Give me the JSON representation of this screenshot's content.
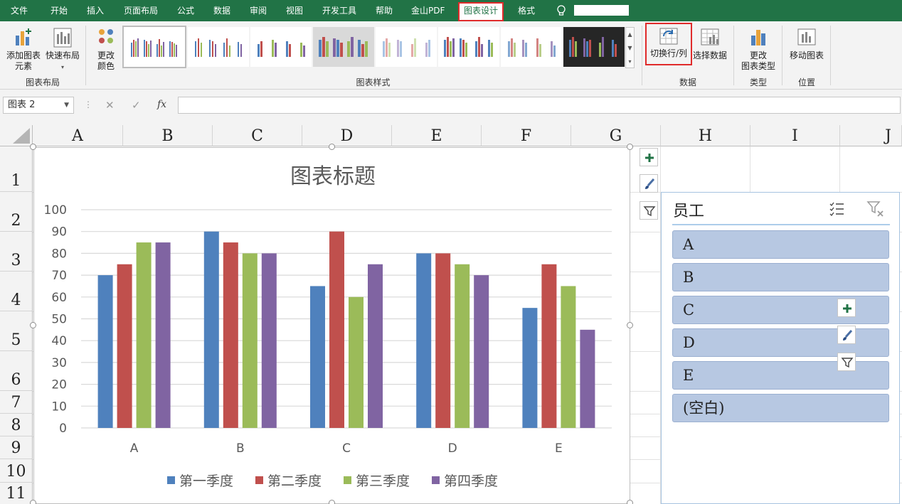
{
  "tabs": [
    "文件",
    "开始",
    "插入",
    "页面布局",
    "公式",
    "数据",
    "审阅",
    "视图",
    "开发工具",
    "帮助",
    "金山PDF",
    "图表设计",
    "格式"
  ],
  "ribbon": {
    "add_element_l1": "添加图表",
    "add_element_l2": "元素",
    "quick_layout": "快速布局",
    "change_color_l1": "更改",
    "change_color_l2": "颜色",
    "group_layout": "图表布局",
    "group_styles": "图表样式",
    "switch_row_col": "切换行/列",
    "select_data": "选择数据",
    "group_data": "数据",
    "change_type_l1": "更改",
    "change_type_l2": "图表类型",
    "group_type": "类型",
    "move_chart": "移动图表",
    "group_location": "位置"
  },
  "formula_bar": {
    "name_box": "图表 2",
    "fx": "fx",
    "cancel": "✕",
    "enter": "✓",
    "value": ""
  },
  "columns": [
    "A",
    "B",
    "C",
    "D",
    "E",
    "F",
    "G",
    "H",
    "I",
    "J"
  ],
  "rows": [
    "1",
    "2",
    "3",
    "4",
    "5",
    "6",
    "7",
    "8",
    "9",
    "10",
    "11"
  ],
  "chart_data": {
    "type": "bar",
    "title": "图表标题",
    "categories": [
      "A",
      "B",
      "C",
      "D",
      "E"
    ],
    "ylim": [
      0,
      100
    ],
    "yticks": [
      "0",
      "10",
      "20",
      "30",
      "40",
      "50",
      "60",
      "70",
      "80",
      "90",
      "100"
    ],
    "grid": true,
    "legend": "bottom",
    "series": [
      {
        "name": "第一季度",
        "color": "#4f81bd",
        "values": [
          70,
          90,
          65,
          80,
          55
        ]
      },
      {
        "name": "第二季度",
        "color": "#c0504d",
        "values": [
          75,
          85,
          90,
          80,
          75
        ]
      },
      {
        "name": "第三季度",
        "color": "#9bbb59",
        "values": [
          85,
          80,
          60,
          75,
          65
        ]
      },
      {
        "name": "第四季度",
        "color": "#8064a2",
        "values": [
          85,
          80,
          75,
          70,
          45
        ]
      }
    ]
  },
  "slicer": {
    "title": "员工",
    "items": [
      "A",
      "B",
      "C",
      "D",
      "E",
      "(空白)"
    ]
  },
  "colors": {
    "excel_green": "#217346",
    "highlight_red": "#e02b2b"
  }
}
